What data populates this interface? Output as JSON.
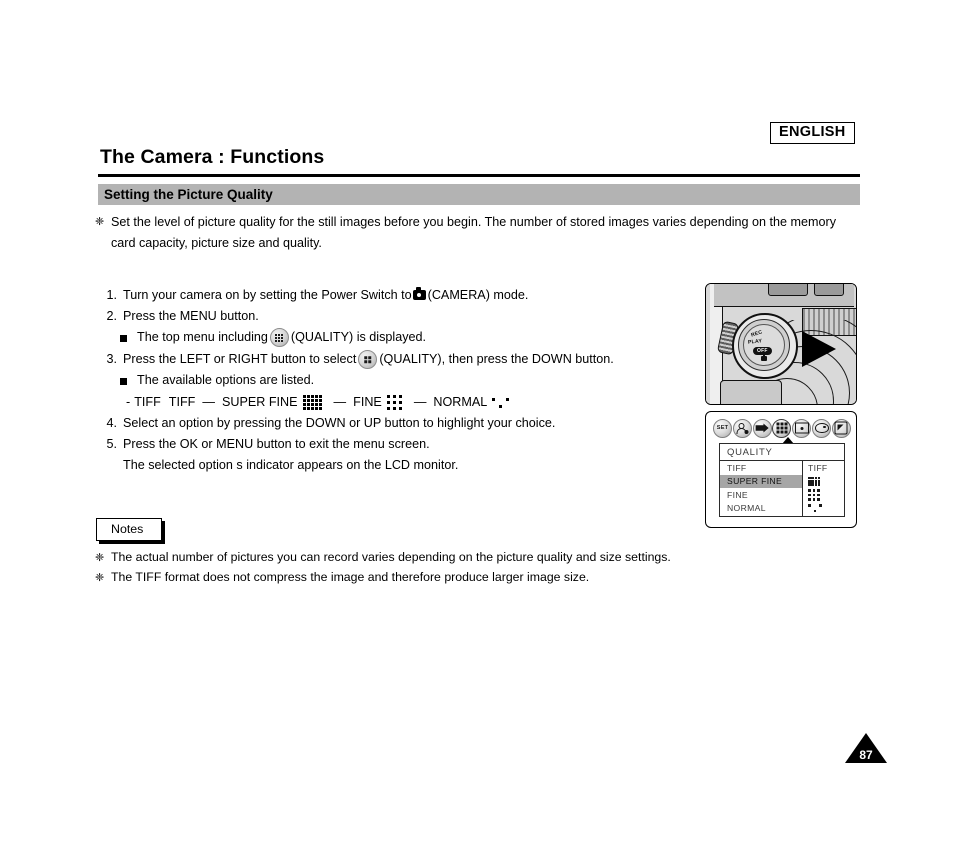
{
  "header": {
    "language_badge": "ENGLISH",
    "chapter_title": "The Camera : Functions",
    "section_title": "Setting the Picture Quality"
  },
  "intro": {
    "bullet_glyph": "❈",
    "text": "Set the level of picture quality for the still images before you begin. The number of stored images varies depending on the memory card capacity, picture size and quality."
  },
  "steps": [
    {
      "num": "1.",
      "text_before": "Turn your camera on by setting the Power Switch to",
      "icon": "camera-mode-icon",
      "text_after": "(CAMERA) mode."
    },
    {
      "num": "2.",
      "text_before": "Press the MENU button.",
      "sub": {
        "text_before": "The top menu including",
        "icon": "quality-menu-icon",
        "text_after": "(QUALITY) is displayed."
      }
    },
    {
      "num": "3.",
      "text_before": "Press the LEFT or RIGHT button to select",
      "icon": "quality-menu-icon",
      "text_after": "(QUALITY), then press the DOWN button.",
      "sub": {
        "text_before": "The available options are listed."
      }
    },
    {
      "num": "4.",
      "text_before": "Select an option by pressing the DOWN or UP button to highlight your choice."
    },
    {
      "num": "5.",
      "text_before": "Press the OK or MENU button to exit the menu screen.",
      "extra": "The selected option s indicator appears on the LCD monitor."
    }
  ],
  "option_line": {
    "lead_dash": "-",
    "items": [
      {
        "label": "TIFF",
        "indicator_text": "TIFF",
        "indicator_type": "text"
      },
      {
        "label": "SUPER FINE",
        "indicator_type": "pattern",
        "pattern": "superfine"
      },
      {
        "label": "FINE",
        "indicator_type": "pattern",
        "pattern": "fine"
      },
      {
        "label": "NORMAL",
        "indicator_type": "pattern",
        "pattern": "normal"
      }
    ],
    "separator": "—"
  },
  "notes": {
    "tab_label": "Notes",
    "items": [
      "The actual number of pictures you can record varies depending on the picture quality and size settings.",
      "The TIFF format does not compress the image and therefore produce larger image size."
    ]
  },
  "camera_illustration": {
    "dial_labels": {
      "rec": "REC",
      "play": "PLAY",
      "off": "OFF",
      "camera_mode": "camera-icon"
    }
  },
  "lcd_menu": {
    "icons": [
      {
        "name": "set-icon",
        "label": "SET",
        "selected": false
      },
      {
        "name": "self-timer-icon",
        "label": "",
        "selected": false
      },
      {
        "name": "flash-icon",
        "label": "",
        "selected": false
      },
      {
        "name": "quality-icon",
        "label": "",
        "selected": true
      },
      {
        "name": "lcd-screen-icon",
        "label": "",
        "selected": false
      },
      {
        "name": "white-balance-icon",
        "label": "",
        "selected": false
      },
      {
        "name": "effect-icon",
        "label": "",
        "selected": false
      }
    ],
    "title": "QUALITY",
    "options": [
      {
        "label": "TIFF",
        "indicator_text": "TIFF",
        "indicator_type": "text",
        "highlighted": false
      },
      {
        "label": "SUPER FINE",
        "indicator_type": "pattern",
        "pattern": "superfine",
        "highlighted": true
      },
      {
        "label": "FINE",
        "indicator_type": "pattern",
        "pattern": "fine",
        "highlighted": false
      },
      {
        "label": "NORMAL",
        "indicator_type": "pattern",
        "pattern": "normal",
        "highlighted": false
      }
    ]
  },
  "page_number": "87",
  "colors": {
    "section_bar": "#b3b3b3",
    "highlight": "#a6a6a6",
    "text": "#000000"
  }
}
